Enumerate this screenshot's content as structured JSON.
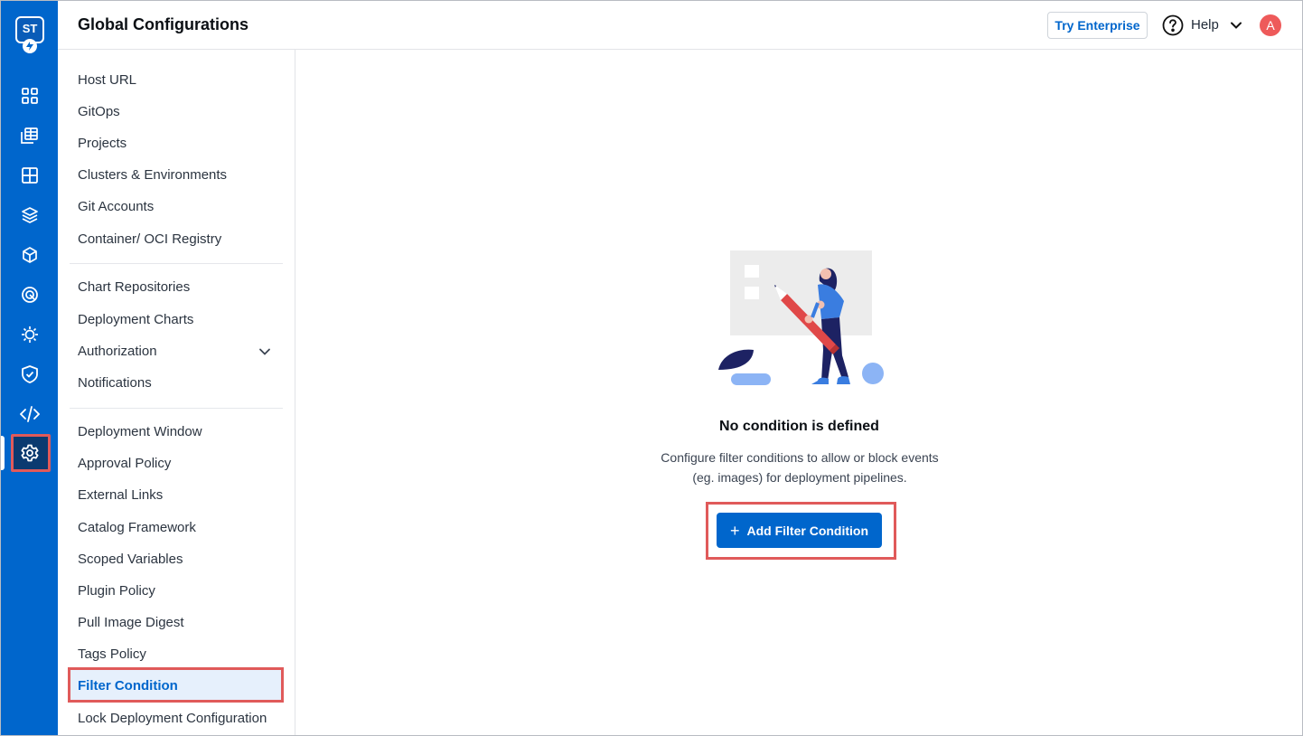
{
  "app": {
    "logo_text": "ST"
  },
  "header": {
    "title": "Global Configurations",
    "try_enterprise": "Try Enterprise",
    "help_label": "Help",
    "avatar_initial": "A"
  },
  "rail": {
    "icons": [
      "apps-grid-icon",
      "app-groups-icon",
      "resource-browser-icon",
      "stack-layers-icon",
      "package-cube-icon",
      "security-scan-icon",
      "bug-icon",
      "shield-check-icon",
      "code-icon",
      "gear-icon"
    ],
    "active": "gear-icon"
  },
  "settings_nav": {
    "items": [
      "Host URL",
      "GitOps",
      "Projects",
      "Clusters & Environments",
      "Git Accounts",
      "Container/ OCI Registry",
      "Chart Repositories",
      "Deployment Charts",
      "Authorization",
      "Notifications",
      "Deployment Window",
      "Approval Policy",
      "External Links",
      "Catalog Framework",
      "Scoped Variables",
      "Plugin Policy",
      "Pull Image Digest",
      "Tags Policy",
      "Filter Condition",
      "Lock Deployment Configuration"
    ],
    "active": "Filter Condition"
  },
  "empty_state": {
    "title": "No condition is defined",
    "description": "Configure filter conditions to allow or block events (eg. images) for deployment pipelines.",
    "button_label": "Add Filter Condition",
    "button_icon": "plus-icon"
  },
  "colors": {
    "brand_blue": "#0066cc",
    "rail_active": "#0b3a70",
    "highlight_red": "#e05a5a",
    "nav_active_bg": "#e6f0fc",
    "avatar": "#ee5a5a"
  }
}
